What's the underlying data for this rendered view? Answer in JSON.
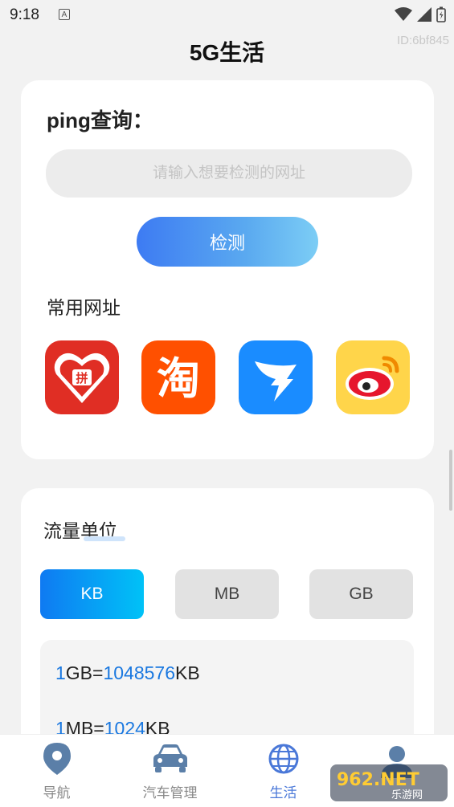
{
  "status_bar": {
    "time": "9:18",
    "notification_icon": "A"
  },
  "header": {
    "title": "5G生活",
    "user_id": "ID:6bf845"
  },
  "ping": {
    "title": "ping查询：",
    "input_placeholder": "请输入想要检测的网址",
    "input_value": "",
    "detect_button": "检测",
    "common_sites_title": "常用网址",
    "apps": [
      {
        "name": "pinduoduo-icon",
        "color": "#e02e24"
      },
      {
        "name": "taobao-icon",
        "color": "#ff5000"
      },
      {
        "name": "dingtalk-icon",
        "color": "#1a8cff"
      },
      {
        "name": "weibo-icon",
        "color": "#ffd54a"
      }
    ]
  },
  "traffic": {
    "title": "流量单位",
    "units": [
      "KB",
      "MB",
      "GB"
    ],
    "selected_unit": "KB",
    "conversions": [
      {
        "lhs_num": "1",
        "lhs_unit": "GB=",
        "rhs_num": "1048576",
        "rhs_unit": "KB"
      },
      {
        "lhs_num": "1",
        "lhs_unit": "MB=",
        "rhs_num": "1024",
        "rhs_unit": "KB"
      }
    ]
  },
  "bottom_nav": {
    "items": [
      {
        "label": "导航",
        "icon": "location-pin-icon"
      },
      {
        "label": "汽车管理",
        "icon": "car-icon"
      },
      {
        "label": "生活",
        "icon": "globe-icon"
      },
      {
        "label": "",
        "icon": "user-icon"
      }
    ],
    "active_index": 2
  },
  "colors": {
    "accent": "#1a78e0",
    "nav_active": "#4a78d8",
    "nav_inactive": "#5b7fa8"
  },
  "watermark": {
    "text": "962.NET",
    "subtext": "乐游网"
  }
}
